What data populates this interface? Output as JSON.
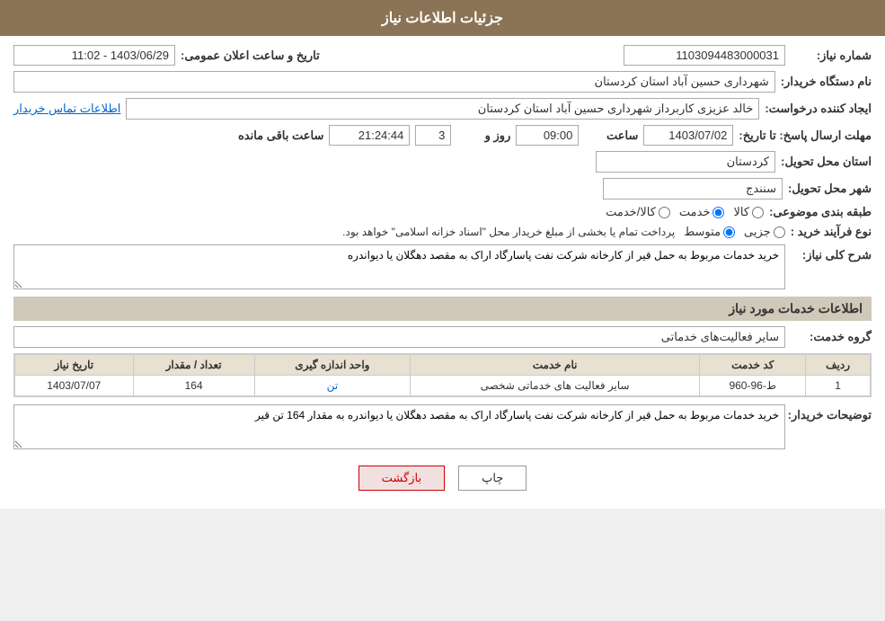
{
  "header": {
    "title": "جزئیات اطلاعات نیاز"
  },
  "fields": {
    "need_number_label": "شماره نیاز:",
    "need_number_value": "1103094483000031",
    "public_announce_label": "تاریخ و ساعت اعلان عمومی:",
    "public_announce_value": "1403/06/29 - 11:02",
    "buyer_org_label": "نام دستگاه خریدار:",
    "buyer_org_value": "شهرداری حسین آباد استان کردستان",
    "requester_label": "ایجاد کننده درخواست:",
    "requester_value": "خالد عزیزی کاربرداز شهرداری حسین آباد استان کردستان",
    "contact_link": "اطلاعات تماس خریدار",
    "send_deadline_label": "مهلت ارسال پاسخ: تا تاریخ:",
    "send_date_value": "1403/07/02",
    "send_time_label": "ساعت",
    "send_time_value": "09:00",
    "send_days_label": "روز و",
    "send_days_value": "3",
    "send_remaining_label": "ساعت باقی مانده",
    "send_remaining_value": "21:24:44",
    "province_label": "استان محل تحویل:",
    "province_value": "کردستان",
    "city_label": "شهر محل تحویل:",
    "city_value": "سنندج",
    "subject_label": "طبقه بندی موضوعی:",
    "subject_options": [
      "کالا",
      "خدمت",
      "کالا/خدمت"
    ],
    "subject_selected": "خدمت",
    "purchase_type_label": "نوع فرآیند خرید :",
    "purchase_options": [
      "جزیی",
      "متوسط"
    ],
    "purchase_notice": "پرداخت تمام یا بخشی از مبلغ خریدار محل \"اسناد خزانه اسلامی\" خواهد بود.",
    "need_desc_label": "شرح کلی نیاز:",
    "need_desc_value": "خرید خدمات مربوط به حمل قیر از کارخانه شرکت نفت پاسارگاد اراک به مقصد دهگلان یا دیواندره",
    "services_info_title": "اطلاعات خدمات مورد نیاز",
    "service_group_label": "گروه خدمت:",
    "service_group_value": "سایر فعالیت‌های خدماتی",
    "table_headers": [
      "ردیف",
      "کد خدمت",
      "نام خدمت",
      "واحد اندازه گیری",
      "تعداد / مقدار",
      "تاریخ نیاز"
    ],
    "table_rows": [
      {
        "row": "1",
        "code": "ط-96-960",
        "name": "سایر فعالیت های خدماتی شخصی",
        "unit": "تن",
        "quantity": "164",
        "date": "1403/07/07"
      }
    ],
    "buyer_desc_label": "توضیحات خریدار:",
    "buyer_desc_value": "خرید خدمات مربوط به حمل قیر از کارخانه شرکت نفت پاسارگاد اراک به مقصد دهگلان یا دیواندره به مقدار 164 تن قیر"
  },
  "buttons": {
    "print": "چاپ",
    "back": "بازگشت"
  }
}
